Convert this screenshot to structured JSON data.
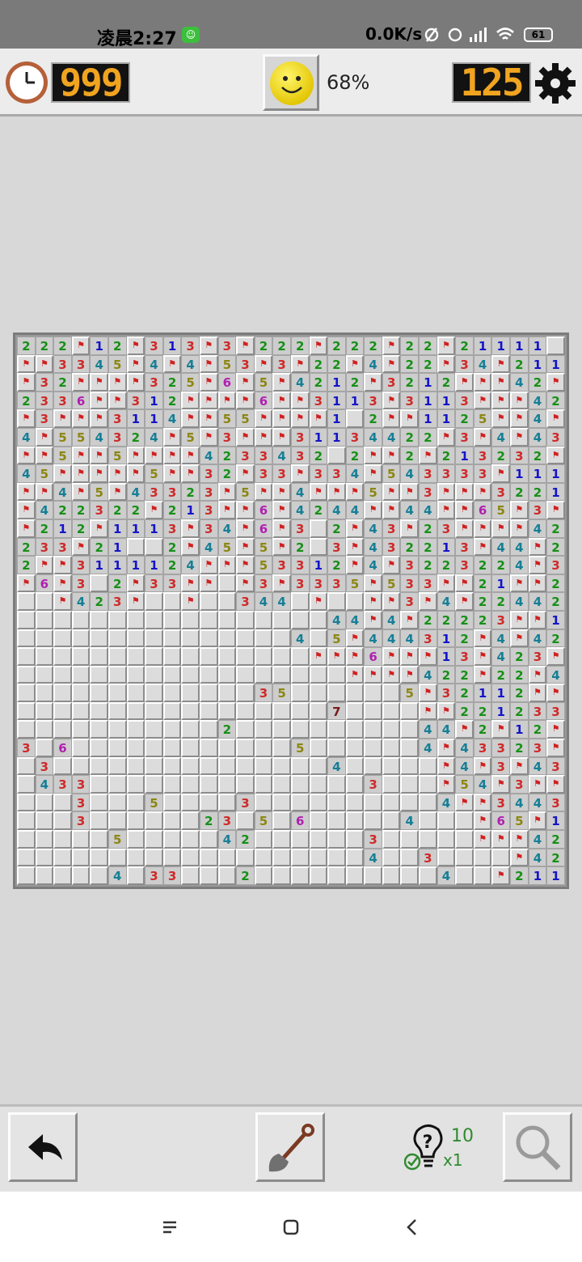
{
  "status_bar": {
    "time": "凌晨2:27",
    "network_speed": "0.0K/s",
    "battery": "61"
  },
  "game": {
    "timer": "999",
    "progress": "68%",
    "mines_remaining": "125",
    "rows": [
      "2 2 2 F 1 2 F 3 1 3 F 3 F 2 2 2 F 2 2 2 F 2 2 F 2 1 1 1 1 .",
      "F F 3 3 4 5 F 4 F 4 F 5 3 F 3 F 2 2 F 4 F 2 2 F 3 4 F 2 1 1",
      "F 3 2 F F F F 3 2 5 F 6 F 5 F 4 2 1 2 F 3 2 1 2 F F F 4 2 F",
      "2 3 3 6 F F 3 1 2 F F F F 6 F F 3 1 1 3 F 3 1 1 3 F F F 4 2",
      "F 3 F F F 3 1 1 4 F F 5 5 F F F F 1 . 2 F F 1 1 2 5 F F 4 F",
      "4 F 5 5 4 3 2 4 F 5 F 3 F F F 3 1 1 3 4 4 2 2 F 3 F 4 F 4 3",
      "F F 5 F F 5 F F F F 4 2 3 3 4 3 2 . 2 F F 2 F 2 1 3 2 3 2 F",
      "4 5 F F F F F 5 F F 3 2 F 3 3 F 3 3 4 F 5 4 3 3 3 3 F 1 1 1",
      "F F 4 F 5 F 4 3 3 2 3 F 5 F F 4 F F F 5 F F 3 F F F 3 2 2 1",
      "F 4 2 2 3 2 2 F 2 1 3 F F 6 F 4 2 4 4 F F 4 4 F F 6 5 F 3 F",
      "F 2 1 2 F 1 1 1 3 F 3 4 F 6 F 3 . 2 F 4 3 F 2 3 F F F F 4 2",
      "2 3 3 F 2 1 . . 2 F 4 5 F 5 F 2 . 3 F 4 3 2 2 1 3 F 4 4 F 2",
      "2 F F 3 1 1 1 1 2 4 F F F 5 3 3 1 2 F 4 F 3 2 2 3 2 2 4 F 3",
      "F 6 F 3 . 2 F 3 3 F F . F 3 F 3 3 3 5 F 5 3 3 F F 2 1 F F 2",
      ". . F 4 2 3 F . . F . . 3 4 4 . F . . F F 3 F 4 F 2 2 4 4 2",
      ". . . . . . . . . . . . . . . . . 4 4 F 4 F 2 2 2 2 3 F F 1",
      ". . . . . . . . . . . . . . . 4 . 5 F 4 4 4 3 1 2 F 4 F 4 2",
      ". . . . . . . . . . . . . . . . F F F 6 F F F 1 3 F 4 2 3 F",
      ". . . . . . . . . . . . . . . . . . F F F F 4 2 2 F 2 2 F 4",
      ". . . . . . . . . . . . . 3 5 . . . . . . 5 F 3 2 1 1 2 F F",
      ". . . . . . . . . . . . . . . . . 7 . . . . F F 2 2 1 2 3 3",
      ". . . . . . . . . . . 2 . . . . . . . . . . 4 4 F 2 F 1 2 F",
      "3 . 6 . . . . . . . . . . . . 5 . . . . . . 4 F 4 3 3 2 3 F",
      ". 3 . . . . . . . . . . . . . . . 4 . . . . . F 4 F 3 F 4 3",
      ". 4 3 3 . . . . . . . . . . . . . . . 3 . . . F 5 4 F 3 F F",
      ". . . 3 . . . 5 . . . . 3 . . . . . . . . . . 4 F F 3 4 4 3",
      ". . . 3 . . . . . . 2 3 . 5 . 6 . . . . . 4 . . . F 6 5 F 1",
      ". . . . . 5 . . . . . 4 2 . . . . . . 3 . . . . . F F F 4 2",
      ". . . . . . . . . . . . . . . . . . . 4 . . 3 . . . . F 4 2",
      ". . . . . 4 . 3 3 . . . 2 . . . . . . . . . . 4 . . F 2 1 1"
    ]
  },
  "hint": {
    "count": "10",
    "multiplier": "x1"
  }
}
